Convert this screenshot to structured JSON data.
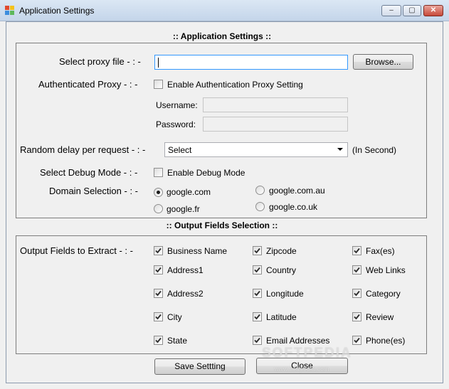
{
  "window": {
    "title": "Application Settings",
    "min_label": "‒",
    "max_label": "▢",
    "close_label": "✕"
  },
  "settings_panel": {
    "title": ":: Application Settings ::",
    "proxy_file": {
      "label": "Select proxy file - : -",
      "value": "",
      "browse_label": "Browse..."
    },
    "auth_proxy": {
      "label": "Authenticated Proxy - : -",
      "checkbox_label": "Enable Authentication Proxy Setting",
      "checked": false,
      "username_label": "Username:",
      "username_value": "",
      "password_label": "Password:",
      "password_value": ""
    },
    "delay": {
      "label": "Random delay per request - : -",
      "selected": "Select",
      "unit": "(In Second)"
    },
    "debug": {
      "label": "Select Debug Mode - : -",
      "checkbox_label": "Enable Debug Mode",
      "checked": false
    },
    "domain": {
      "label": "Domain Selection - : -",
      "options": [
        {
          "label": "google.com",
          "selected": true
        },
        {
          "label": "google.com.au",
          "selected": false
        },
        {
          "label": "google.fr",
          "selected": false
        },
        {
          "label": "google.co.uk",
          "selected": false
        }
      ]
    }
  },
  "output_panel": {
    "title": ":: Output Fields Selection ::",
    "label": "Output Fields to Extract - : -",
    "fields": [
      {
        "label": "Business Name",
        "checked": true
      },
      {
        "label": "Zipcode",
        "checked": true
      },
      {
        "label": "Fax(es)",
        "checked": true
      },
      {
        "label": "Address1",
        "checked": true
      },
      {
        "label": "Country",
        "checked": true
      },
      {
        "label": "Web Links",
        "checked": true
      },
      {
        "label": "Address2",
        "checked": true
      },
      {
        "label": "Longitude",
        "checked": true
      },
      {
        "label": "Category",
        "checked": true
      },
      {
        "label": "City",
        "checked": true
      },
      {
        "label": "Latitude",
        "checked": true
      },
      {
        "label": "Review",
        "checked": true
      },
      {
        "label": "State",
        "checked": true
      },
      {
        "label": "Email Addresses",
        "checked": true
      },
      {
        "label": "Phone(es)",
        "checked": true
      }
    ]
  },
  "actions": {
    "save_label": "Save Settting",
    "close_label": "Close"
  },
  "watermark": {
    "brand": "SOFTPEDIA",
    "url": "www.softpedia.com"
  }
}
